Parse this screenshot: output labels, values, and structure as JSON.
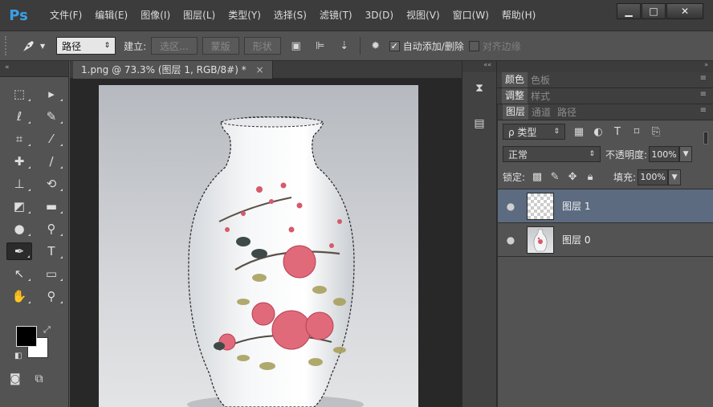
{
  "app": {
    "logo": "Ps",
    "menu": [
      "文件(F)",
      "编辑(E)",
      "图像(I)",
      "图层(L)",
      "类型(Y)",
      "选择(S)",
      "滤镜(T)",
      "3D(D)",
      "视图(V)",
      "窗口(W)",
      "帮助(H)"
    ],
    "window_controls": {
      "minimize": "▁",
      "maximize": "□",
      "close": "✕"
    }
  },
  "options_bar": {
    "tool_icon": "pen-tool-icon",
    "mode_value": "路径",
    "make_label": "建立:",
    "selection_button": "选区...",
    "mask_button": "蒙版",
    "shape_button": "形状",
    "auto_add_delete": {
      "label": "自动添加/删除",
      "checked": true
    },
    "align_edges": {
      "label": "对齐边缘",
      "checked": false
    }
  },
  "document": {
    "tab_title": "1.png @ 73.3% (图层 1, RGB/8#) *",
    "close_glyph": "×"
  },
  "tools": [
    {
      "name": "marquee-tool-icon",
      "glyph": "⬚"
    },
    {
      "name": "move-tool-icon",
      "glyph": "▸"
    },
    {
      "name": "lasso-tool-icon",
      "glyph": "ℓ"
    },
    {
      "name": "quick-select-tool-icon",
      "glyph": "✎"
    },
    {
      "name": "crop-tool-icon",
      "glyph": "⌗"
    },
    {
      "name": "eyedropper-tool-icon",
      "glyph": "⁄"
    },
    {
      "name": "healing-brush-tool-icon",
      "glyph": "✚"
    },
    {
      "name": "brush-tool-icon",
      "glyph": "∕"
    },
    {
      "name": "clone-stamp-tool-icon",
      "glyph": "⊥"
    },
    {
      "name": "history-brush-tool-icon",
      "glyph": "⟲"
    },
    {
      "name": "eraser-tool-icon",
      "glyph": "◩"
    },
    {
      "name": "gradient-tool-icon",
      "glyph": "▬"
    },
    {
      "name": "paint-bucket-tool-icon",
      "glyph": "●"
    },
    {
      "name": "dodge-tool-icon",
      "glyph": "⚲"
    },
    {
      "name": "pen-tool-icon",
      "glyph": "✒",
      "active": true
    },
    {
      "name": "type-tool-icon",
      "glyph": "T"
    },
    {
      "name": "path-select-tool-icon",
      "glyph": "↖"
    },
    {
      "name": "rectangle-tool-icon",
      "glyph": "▭"
    },
    {
      "name": "hand-tool-icon",
      "glyph": "✋"
    },
    {
      "name": "zoom-tool-icon",
      "glyph": "⚲"
    }
  ],
  "colors": {
    "foreground": "#000000",
    "background": "#ffffff",
    "selected_layer": "#5c6b80",
    "logo": "#3aa0e6"
  },
  "panels": {
    "color_tabs": [
      "颜色",
      "色板"
    ],
    "adjust_tabs": [
      "调整",
      "样式"
    ],
    "layer_tabs": [
      "图层",
      "通道",
      "路径"
    ],
    "filter_label": "ρ 类型",
    "blend_mode": "正常",
    "opacity_label": "不透明度:",
    "opacity_value": "100%",
    "lock_label": "锁定:",
    "fill_label": "填充:",
    "fill_value": "100%",
    "layers": [
      {
        "name": "图层 1",
        "selected": true,
        "visible": true,
        "thumb": "transparent"
      },
      {
        "name": "图层 0",
        "selected": false,
        "visible": true,
        "thumb": "vase"
      }
    ]
  }
}
